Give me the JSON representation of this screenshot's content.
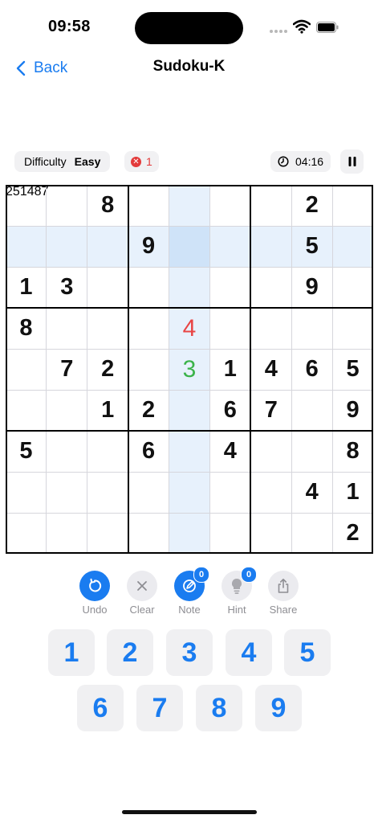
{
  "status": {
    "time": "09:58"
  },
  "nav": {
    "back_label": "Back",
    "title": "Sudoku-K"
  },
  "info": {
    "difficulty_label": "Difficulty",
    "difficulty_value": "Easy",
    "mistakes": "1",
    "timer": "04:16"
  },
  "colors": {
    "accent": "#1a7cf0",
    "error": "#e84545",
    "correct": "#3bb34a",
    "highlight": "#e7f1fc",
    "selected": "#cfe3f8"
  },
  "grid": {
    "selected_row": 1,
    "selected_col": 4,
    "values": [
      [
        "",
        "",
        "8",
        "",
        "",
        "",
        "",
        "2",
        ""
      ],
      [
        "",
        "",
        "",
        "9",
        "",
        "",
        "",
        "5",
        ""
      ],
      [
        "1",
        "3",
        "",
        "",
        "",
        "",
        "",
        "9",
        ""
      ],
      [
        "8",
        "",
        "",
        "",
        "4",
        "",
        "",
        "",
        ""
      ],
      [
        "",
        "7",
        "2",
        "",
        "3",
        "1",
        "4",
        "6",
        "5"
      ],
      [
        "",
        "",
        "1",
        "2",
        "",
        "6",
        "7",
        "",
        "9"
      ],
      [
        "5",
        "",
        "",
        "6",
        "",
        "4",
        "",
        "",
        "8"
      ],
      [
        "",
        "",
        "",
        "",
        "",
        "",
        "",
        "4",
        "1"
      ],
      [
        "",
        "",
        "",
        "",
        "",
        "",
        "",
        "",
        "2"
      ]
    ],
    "entry_status": [
      {
        "row": 3,
        "col": 4,
        "status": "error"
      },
      {
        "row": 4,
        "col": 4,
        "status": "correct"
      }
    ],
    "notes": [
      {
        "row": 1,
        "col": 4,
        "digit": "2"
      },
      {
        "row": 2,
        "col": 3,
        "digit": "5"
      },
      {
        "row": 2,
        "col": 4,
        "digit": "1"
      },
      {
        "row": 5,
        "col": 1,
        "digit": "4"
      },
      {
        "row": 5,
        "col": 4,
        "digit": "8"
      },
      {
        "row": 6,
        "col": 4,
        "digit": "7"
      }
    ]
  },
  "toolbar": {
    "undo": "Undo",
    "clear": "Clear",
    "note": "Note",
    "note_badge": "0",
    "hint": "Hint",
    "hint_badge": "0",
    "share": "Share"
  },
  "keypad": [
    "1",
    "2",
    "3",
    "4",
    "5",
    "6",
    "7",
    "8",
    "9"
  ]
}
